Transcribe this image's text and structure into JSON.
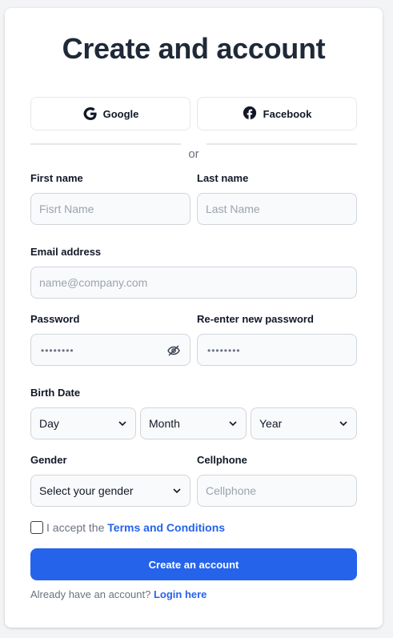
{
  "title": "Create and account",
  "social": {
    "google_label": "Google",
    "facebook_label": "Facebook"
  },
  "divider_text": "or",
  "first_name": {
    "label": "First name",
    "placeholder": "Fisrt Name"
  },
  "last_name": {
    "label": "Last name",
    "placeholder": "Last Name"
  },
  "email": {
    "label": "Email address",
    "placeholder": "name@company.com"
  },
  "password": {
    "label": "Password",
    "value": "••••••••"
  },
  "reenter_password": {
    "label": "Re-enter new password",
    "value": "••••••••"
  },
  "birth_date": {
    "label": "Birth Date",
    "day": "Day",
    "month": "Month",
    "year": "Year"
  },
  "gender": {
    "label": "Gender",
    "selected": "Select your gender"
  },
  "cellphone": {
    "label": "Cellphone",
    "placeholder": "Cellphone"
  },
  "terms": {
    "prefix": "I accept the",
    "link": "Terms and Conditions"
  },
  "submit_label": "Create an account",
  "login": {
    "prefix": "Already have an account?",
    "link": "Login here"
  },
  "colors": {
    "primary": "#2563eb",
    "google": "#111827",
    "facebook": "#111827"
  },
  "icons": {
    "google": "google-icon",
    "facebook": "facebook-icon",
    "eye": "eye-slash-icon",
    "chevron": "chevron-down-icon"
  }
}
